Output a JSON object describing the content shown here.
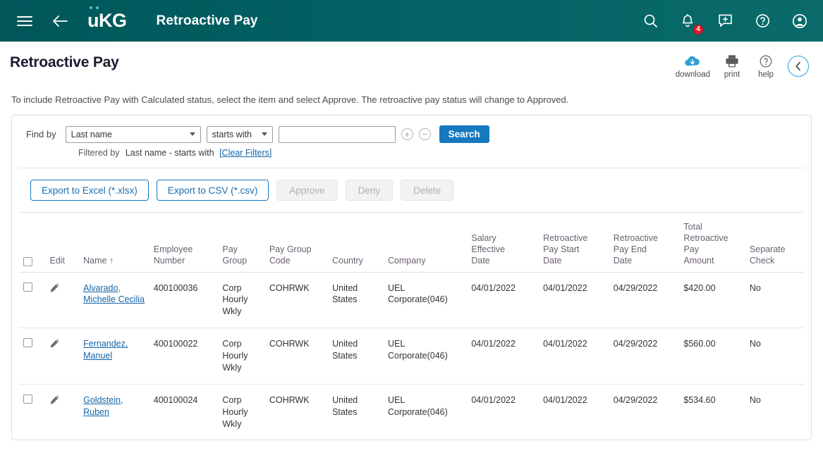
{
  "appbar": {
    "menu_icon": "hamburger-icon",
    "back_icon": "back-arrow-icon",
    "logo_text": "KG",
    "logo_u": "u",
    "title": "Retroactive Pay",
    "search_icon": "search-icon",
    "notifications_icon": "bell-icon",
    "notifications_count": "4",
    "feedback_icon": "message-plus-icon",
    "help_icon": "help-circle-icon",
    "profile_icon": "user-avatar-icon",
    "background_color": "#005659",
    "badge_color": "#d81b2a",
    "logo_dot_color": "#46d2b4"
  },
  "page": {
    "title": "Retroactive Pay",
    "instruction": "To include Retroactive Pay with Calculated status, select the item and select Approve. The retroactive pay status will change to Approved."
  },
  "tools": [
    {
      "icon": "cloud-download-icon",
      "label": "download"
    },
    {
      "icon": "printer-icon",
      "label": "print"
    },
    {
      "icon": "help-circle-icon",
      "label": "help"
    }
  ],
  "collapse": {
    "icon": "chevron-left-icon",
    "accent_color": "#2b9fd8"
  },
  "filter": {
    "find_by_label": "Find by",
    "field_select": "Last name",
    "operator_select": "starts with",
    "value": "",
    "value_placeholder": "",
    "add_icon": "plus-circle-icon",
    "remove_icon": "minus-circle-icon",
    "search_button": "Search",
    "search_button_color": "#1679c0",
    "filtered_by_label": "Filtered by",
    "filtered_by_value": "Last name - starts with",
    "clear_filters": "[Clear Filters]"
  },
  "actions": {
    "export_excel": "Export to Excel (*.xlsx)",
    "export_csv": "Export to CSV (*.csv)",
    "approve": "Approve",
    "deny": "Deny",
    "delete": "Delete",
    "outline_color": "#1679c0"
  },
  "table": {
    "sort_indicator": "↑",
    "columns": [
      "",
      "Edit",
      "Name",
      "Employee Number",
      "Pay Group",
      "Pay Group Code",
      "Country",
      "Company",
      "Salary Effective Date",
      "Retroactive Pay Start Date",
      "Retroactive Pay End Date",
      "Total Retroactive Pay Amount",
      "Separate Check"
    ],
    "headers": {
      "edit": "Edit",
      "name": "Name",
      "employee_number_l1": "Employee",
      "employee_number_l2": "Number",
      "pay_group_l1": "Pay",
      "pay_group_l2": "Group",
      "pay_group_code_l1": "Pay Group",
      "pay_group_code_l2": "Code",
      "country": "Country",
      "company": "Company",
      "salary_effective_l1": "Salary",
      "salary_effective_l2": "Effective",
      "salary_effective_l3": "Date",
      "retro_start_l1": "Retroactive",
      "retro_start_l2": "Pay Start",
      "retro_start_l3": "Date",
      "retro_end_l1": "Retroactive",
      "retro_end_l2": "Pay End",
      "retro_end_l3": "Date",
      "total_amount_l1": "Total",
      "total_amount_l2": "Retroactive",
      "total_amount_l3": "Pay",
      "total_amount_l4": "Amount",
      "separate_check_l1": "Separate",
      "separate_check_l2": "Check"
    },
    "rows": [
      {
        "name": "Alvarado, Michelle Cecilia",
        "employee_number": "400100036",
        "pay_group": "Corp Hourly Wkly",
        "pay_group_code": "COHRWK",
        "country": "United States",
        "company": "UEL Corporate(046)",
        "salary_effective_date": "04/01/2022",
        "retro_pay_start_date": "04/01/2022",
        "retro_pay_end_date": "04/29/2022",
        "total_retro_pay_amount": "$420.00",
        "separate_check": "No"
      },
      {
        "name": "Fernandez, Manuel",
        "employee_number": "400100022",
        "pay_group": "Corp Hourly Wkly",
        "pay_group_code": "COHRWK",
        "country": "United States",
        "company": "UEL Corporate(046)",
        "salary_effective_date": "04/01/2022",
        "retro_pay_start_date": "04/01/2022",
        "retro_pay_end_date": "04/29/2022",
        "total_retro_pay_amount": "$560.00",
        "separate_check": "No"
      },
      {
        "name": "Goldstein, Ruben",
        "employee_number": "400100024",
        "pay_group": "Corp Hourly Wkly",
        "pay_group_code": "COHRWK",
        "country": "United States",
        "company": "UEL Corporate(046)",
        "salary_effective_date": "04/01/2022",
        "retro_pay_start_date": "04/01/2022",
        "retro_pay_end_date": "04/29/2022",
        "total_retro_pay_amount": "$534.60",
        "separate_check": "No"
      }
    ]
  }
}
